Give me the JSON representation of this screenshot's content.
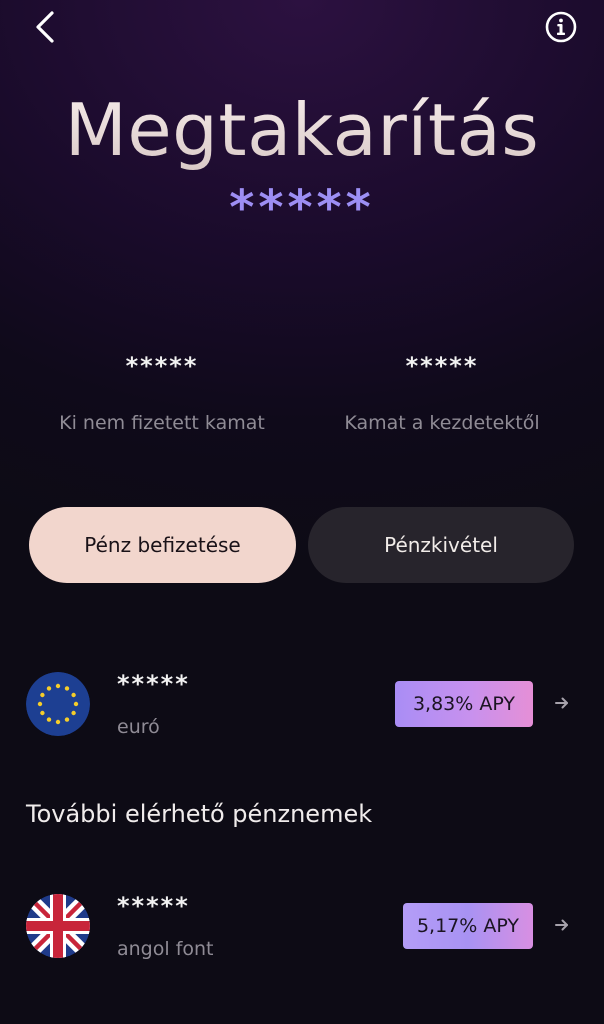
{
  "header": {
    "title": "Megtakarítás",
    "balance_masked": "*****"
  },
  "stats": {
    "unpaid_interest": {
      "value": "*****",
      "label": "Ki nem fizetett kamat"
    },
    "interest_since_start": {
      "value": "*****",
      "label": "Kamat a kezdetektől"
    }
  },
  "actions": {
    "deposit_label": "Pénz befizetése",
    "withdraw_label": "Pénzkivétel"
  },
  "accounts": [
    {
      "amount": "*****",
      "currency_name": "euró",
      "apy": "3,83% APY",
      "flag_icon": "eu-flag-icon"
    }
  ],
  "other_section": {
    "title": "További elérhető pénznemek",
    "items": [
      {
        "amount": "*****",
        "currency_name": "angol font",
        "apy": "5,17% APY",
        "flag_icon": "uk-flag-icon"
      }
    ]
  },
  "colors": {
    "deposit_button": "#f2d6cd",
    "withdraw_button": "#27242c",
    "accent_purple": "#a98df5"
  }
}
